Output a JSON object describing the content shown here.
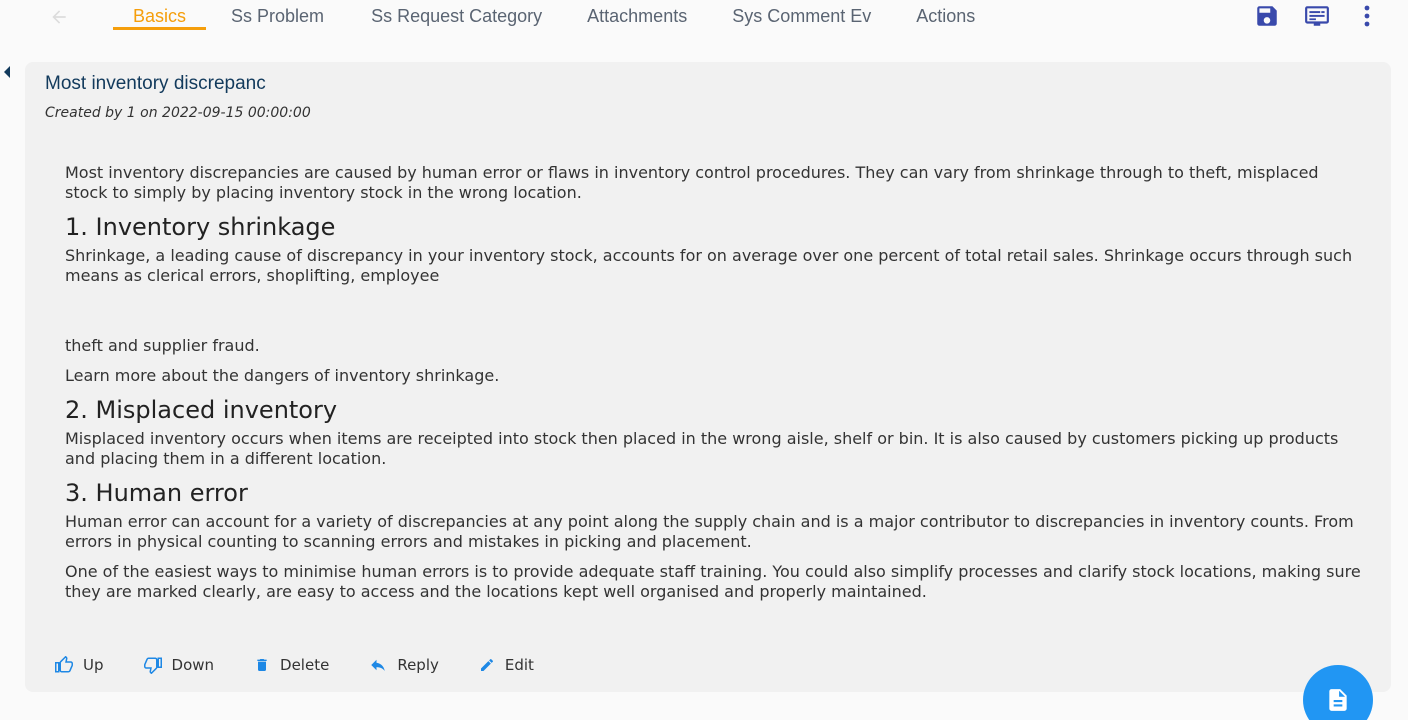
{
  "nav": {
    "tabs": [
      {
        "label": "Basics",
        "active": true
      },
      {
        "label": "Ss Problem"
      },
      {
        "label": "Ss Request Category"
      },
      {
        "label": "Attachments"
      },
      {
        "label": "Sys Comment Ev"
      },
      {
        "label": "Actions"
      }
    ],
    "icons": [
      "arrow-back-icon",
      "save-icon",
      "subtitles-icon",
      "more-vert-icon"
    ]
  },
  "card": {
    "title": "Most inventory discrepanc",
    "meta": "Created by 1 on 2022-09-15 00:00:00"
  },
  "article": {
    "intro": "Most inventory discrepancies are caused by human error or flaws in inventory control procedures. They can vary from shrinkage through to theft, misplaced stock to simply by placing inventory stock in the wrong location.",
    "h1": "1. Inventory shrinkage",
    "p1": "Shrinkage, a leading cause of discrepancy in your inventory stock, accounts for on average over one percent of total retail sales. Shrinkage occurs through such means as clerical errors, shoplifting, employee",
    "p2": "theft and supplier fraud.",
    "p3": "Learn more about the dangers of inventory shrinkage.",
    "h2": "2. Misplaced inventory",
    "p4": "Misplaced inventory occurs when items are receipted into stock then placed in the wrong aisle, shelf or bin. It is also caused by customers picking up products and placing them in a different location.",
    "h3": "3. Human error",
    "p5": "Human error can account for a variety of discrepancies at any point along the supply chain and is a major contributor to discrepancies in inventory counts. From errors in physical counting to scanning errors and mistakes in picking and placement.",
    "p6": "One of the easiest ways to minimise human errors is to provide adequate staff training. You could also simplify processes and clarify stock locations, making sure they are marked clearly, are easy to access and the locations kept well organised and properly maintained."
  },
  "actions": {
    "up": "Up",
    "down": "Down",
    "delete": "Delete",
    "reply": "Reply",
    "edit": "Edit"
  },
  "colors": {
    "accent": "#f59e0b",
    "primary": "#2196f3",
    "icon_navy": "#3949ab",
    "title": "#123a5c"
  }
}
